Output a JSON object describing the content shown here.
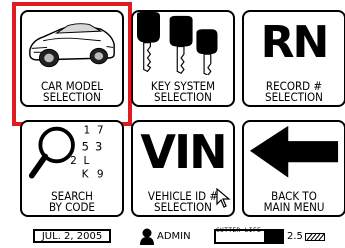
{
  "tiles": [
    {
      "id": "car-model",
      "lines": [
        "CAR MODEL",
        "SELECTION"
      ],
      "selected": true
    },
    {
      "id": "key-system",
      "lines": [
        "KEY SYSTEM",
        "SELECTION"
      ]
    },
    {
      "id": "record",
      "big": "RN",
      "lines": [
        "RECORD #",
        "SELECTION"
      ]
    },
    {
      "id": "search-code",
      "lines": [
        "SEARCH",
        "BY CODE"
      ],
      "digits": [
        "1",
        "7",
        "5",
        "3",
        "2",
        "L",
        "K",
        "9"
      ]
    },
    {
      "id": "vin",
      "big": "VIN",
      "lines": [
        "VEHICLE ID #",
        "SELECTION"
      ]
    },
    {
      "id": "back",
      "lines": [
        "BACK TO",
        "MAIN MENU"
      ]
    }
  ],
  "status": {
    "date": "JUL. 2, 2005",
    "user": "ADMIN",
    "cutter_label": "CUTTER LIFE",
    "cutter_value": "2.5",
    "cutter_level": 0.28
  },
  "colors": {
    "selection": "#e21b23"
  }
}
